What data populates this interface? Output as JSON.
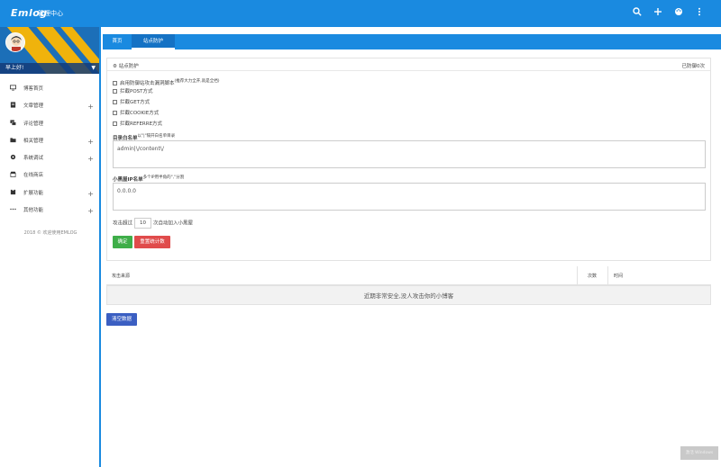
{
  "header": {
    "logo_text": "Emlog",
    "subtitle": "管理中心"
  },
  "sidebar": {
    "greeting": "早上好!",
    "items": [
      {
        "label": "博客首页",
        "has_children": false
      },
      {
        "label": "文章管理",
        "has_children": true
      },
      {
        "label": "评论管理",
        "has_children": false
      },
      {
        "label": "相关管理",
        "has_children": true
      },
      {
        "label": "系统调试",
        "has_children": true
      },
      {
        "label": "在线商店",
        "has_children": false
      },
      {
        "label": "扩展功能",
        "has_children": true
      },
      {
        "label": "其他功能",
        "has_children": true
      }
    ],
    "footer": "2018 © 欢迎使用EMLOG"
  },
  "tabs": [
    {
      "label": "首页"
    },
    {
      "label": "站点防护"
    }
  ],
  "panel": {
    "title": "站点防护",
    "status": "已防御0次",
    "options": [
      {
        "label": "启用防御站攻击漏洞脚本",
        "note": "(推荐大力全开,就是全挡)"
      },
      {
        "label": "拦截POST方式",
        "note": ""
      },
      {
        "label": "拦截GET方式",
        "note": ""
      },
      {
        "label": "拦截COOKIE方式",
        "note": ""
      },
      {
        "label": "拦截REFERRE方式",
        "note": ""
      }
    ],
    "whitelist_label": "目录白名单",
    "whitelist_note": "以\"|\"隔开白名单目录",
    "whitelist_value": "admin|\\/content\\/",
    "ip_label": "小黑屋IP名单",
    "ip_note": "多个IP用半角的\",\"分割",
    "ip_value": "0.0.0.0",
    "attack_prefix": "攻击超过",
    "attack_count": "10",
    "attack_suffix": "次自动加入小黑屋",
    "confirm_label": "确定",
    "reset_label": "重置统计数"
  },
  "table": {
    "columns": [
      "攻击来源",
      "次数",
      "时间"
    ],
    "empty_message": "近期非常安全,没人攻击你的小博客"
  },
  "clear_button": "清空数据",
  "watermark": "激活 Windows",
  "colors": {
    "primary": "#1a8ae0",
    "success": "#3fae49",
    "danger": "#e04b4b",
    "clear": "#3b5fc2",
    "banner_yellow": "#f0b30c"
  }
}
